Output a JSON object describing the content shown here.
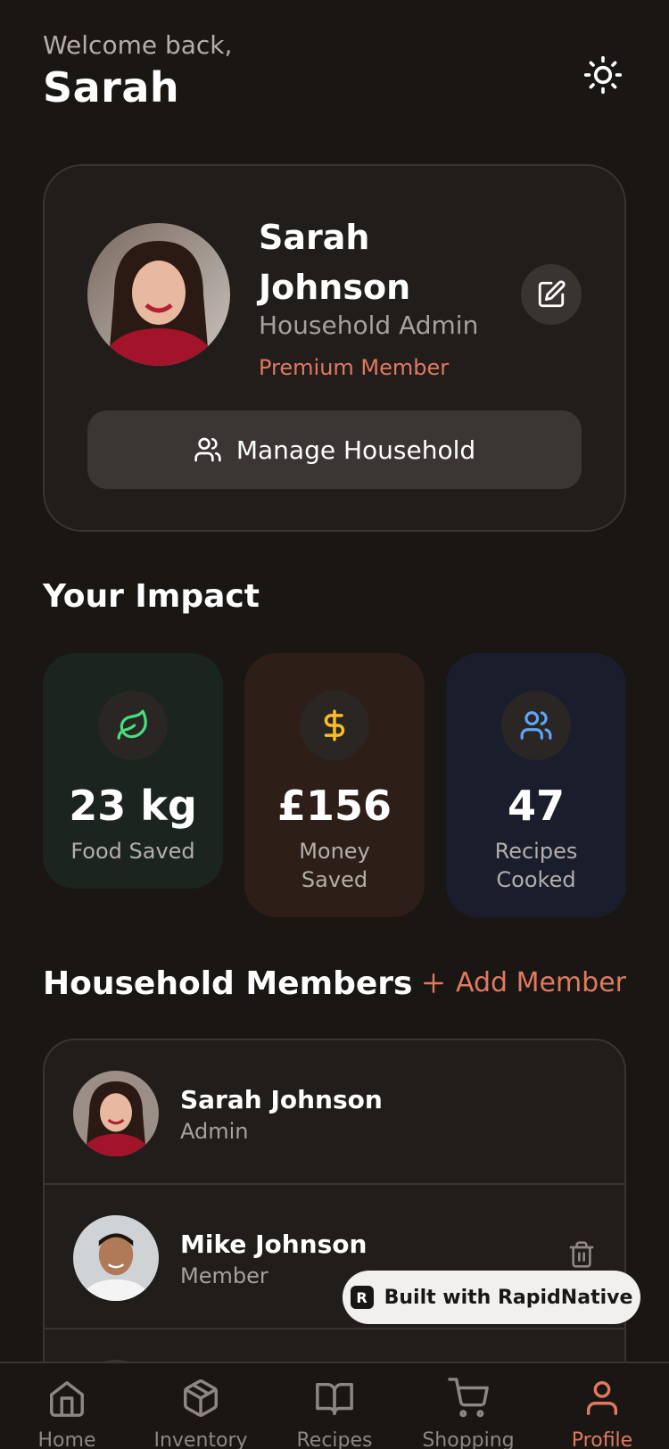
{
  "header": {
    "welcome": "Welcome back,",
    "name": "Sarah"
  },
  "profile": {
    "name": "Sarah Johnson",
    "role": "Household Admin",
    "membership": "Premium Member",
    "manage_label": "Manage Household"
  },
  "impact": {
    "title": "Your Impact",
    "stats": [
      {
        "value": "23 kg",
        "label": "Food Saved",
        "icon": "leaf-icon",
        "color": "#4ade80"
      },
      {
        "value": "£156",
        "label": "Money Saved",
        "icon": "dollar-icon",
        "color": "#fbbf24"
      },
      {
        "value": "47",
        "label": "Recipes Cooked",
        "icon": "users-icon",
        "color": "#60a5fa"
      }
    ]
  },
  "members": {
    "title": "Household Members",
    "add_label": "Add Member",
    "items": [
      {
        "name": "Sarah Johnson",
        "role": "Admin"
      },
      {
        "name": "Mike Johnson",
        "role": "Member"
      }
    ]
  },
  "badge": {
    "label": "Built with RapidNative"
  },
  "tabs": [
    {
      "label": "Home",
      "icon": "home-icon"
    },
    {
      "label": "Inventory",
      "icon": "box-icon"
    },
    {
      "label": "Recipes",
      "icon": "book-icon"
    },
    {
      "label": "Shopping",
      "icon": "cart-icon"
    },
    {
      "label": "Profile",
      "icon": "user-icon",
      "active": true
    }
  ],
  "colors": {
    "background": "#1a1614",
    "accent": "#e07a5f",
    "card": "#211d1b"
  }
}
